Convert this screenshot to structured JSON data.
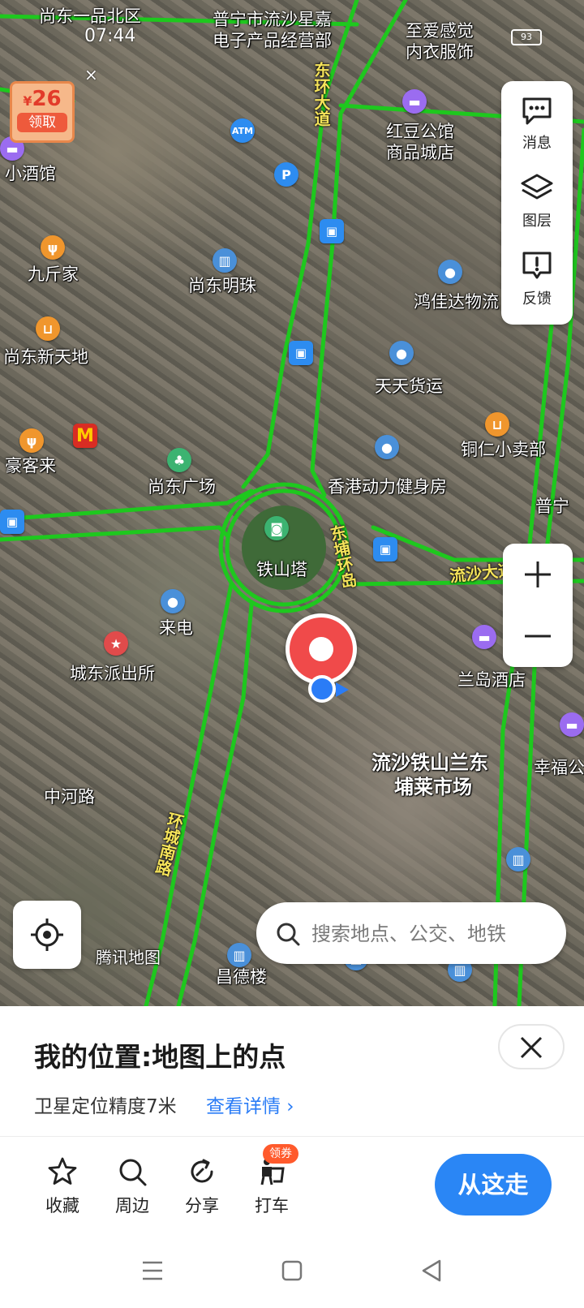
{
  "status_bar": {
    "time": "07:44",
    "battery": "93"
  },
  "coupon": {
    "currency": "¥",
    "amount": "26",
    "claim_label": "领取",
    "close_glyph": "×"
  },
  "map": {
    "place_labels": [
      {
        "text": "尚东一品北区"
      },
      {
        "text": "普宁市流沙星嘉"
      },
      {
        "text": "电子产品经营部"
      },
      {
        "text": "至爱感觉"
      },
      {
        "text": "内衣服饰"
      },
      {
        "text": "红豆公馆"
      },
      {
        "text": "商品城店"
      },
      {
        "text": "小酒馆"
      },
      {
        "text": "九斤家"
      },
      {
        "text": "尚东明珠"
      },
      {
        "text": "鸿佳达物流"
      },
      {
        "text": "尚东新天地"
      },
      {
        "text": "天天货运"
      },
      {
        "text": "豪客来"
      },
      {
        "text": "尚东广场"
      },
      {
        "text": "香港动力健身房"
      },
      {
        "text": "铜仁小卖部"
      },
      {
        "text": "普宁"
      },
      {
        "text": "铁山塔"
      },
      {
        "text": "来电"
      },
      {
        "text": "城东派出所"
      },
      {
        "text": "兰岛酒店"
      },
      {
        "text": "流沙铁山兰东"
      },
      {
        "text": "埔莱市场"
      },
      {
        "text": "幸福公"
      },
      {
        "text": "中河路"
      },
      {
        "text": "昌德楼"
      }
    ],
    "road_labels": [
      {
        "text": "东环大道"
      },
      {
        "text": "东埔环岛"
      },
      {
        "text": "流沙大道"
      },
      {
        "text": "环城南路"
      }
    ],
    "watermark": "腾讯地图"
  },
  "side_panel": {
    "items": [
      {
        "icon": "message-icon",
        "label": "消息"
      },
      {
        "icon": "layers-icon",
        "label": "图层"
      },
      {
        "icon": "feedback-icon",
        "label": "反馈"
      }
    ]
  },
  "search": {
    "placeholder": "搜索地点、公交、地铁"
  },
  "sheet": {
    "title": "我的位置:地图上的点",
    "accuracy": "卫星定位精度7米",
    "detail_link": "查看详情 ›",
    "actions": [
      {
        "icon": "star-icon",
        "label": "收藏"
      },
      {
        "icon": "search-icon",
        "label": "周边"
      },
      {
        "icon": "share-icon",
        "label": "分享"
      },
      {
        "icon": "taxi-icon",
        "label": "打车",
        "badge": "领券"
      }
    ],
    "go_button": "从这走"
  },
  "colors": {
    "accent": "#2a86f5",
    "route_green": "#1ec81e",
    "marker_red": "#f04a4a"
  }
}
